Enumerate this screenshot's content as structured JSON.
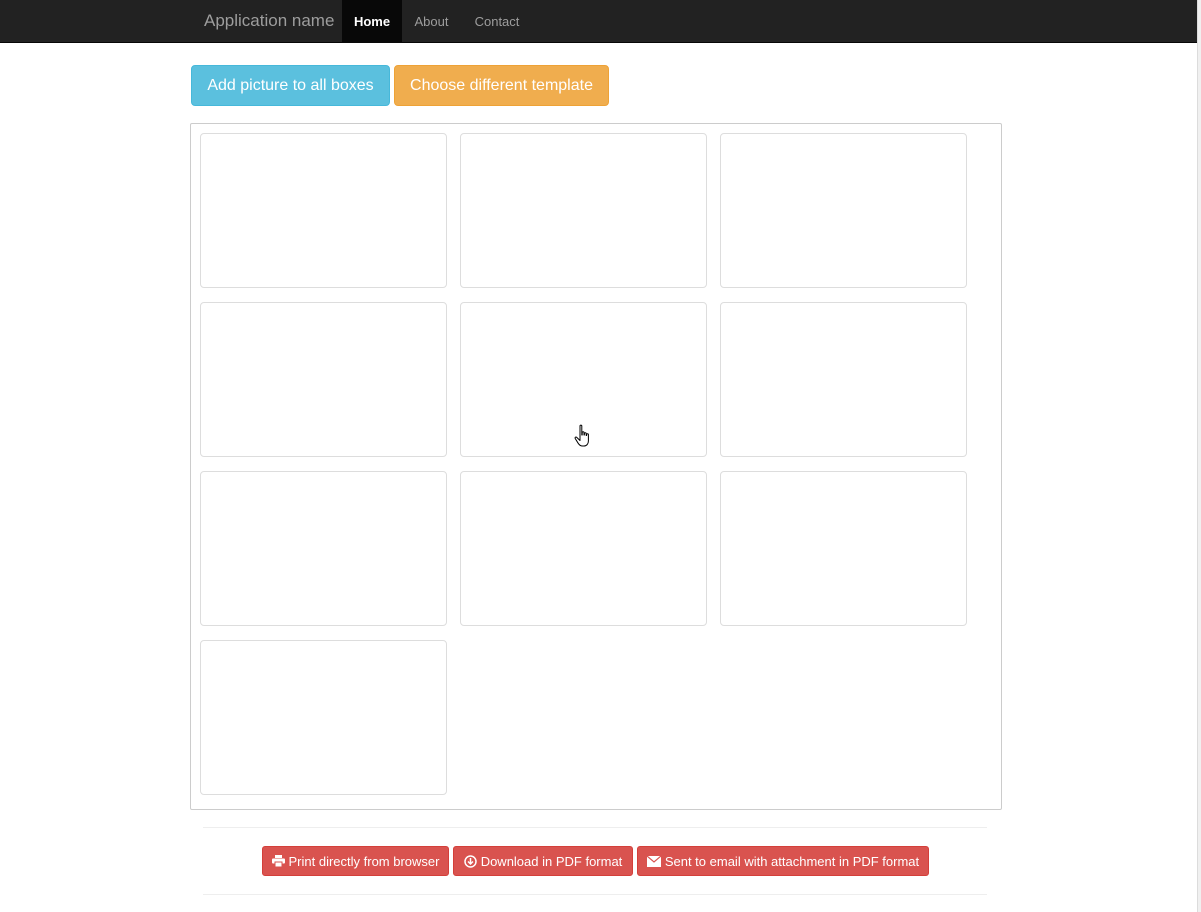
{
  "navbar": {
    "brand": "Application name",
    "items": [
      {
        "label": "Home",
        "active": true
      },
      {
        "label": "About",
        "active": false
      },
      {
        "label": "Contact",
        "active": false
      }
    ]
  },
  "toolbar": {
    "add_picture_label": "Add picture to all boxes",
    "choose_template_label": "Choose different template"
  },
  "grid": {
    "box_count": 10
  },
  "footer": {
    "print_label": "Print directly from browser",
    "download_label": "Download in PDF format",
    "email_label": "Sent to email with attachment in PDF format",
    "print_icon": "printer-icon",
    "download_icon": "download-circle-icon",
    "email_icon": "envelope-icon"
  },
  "colors": {
    "navbar_bg": "#222222",
    "info": "#5bc0de",
    "warning": "#f0ad4e",
    "danger": "#d9534f"
  }
}
